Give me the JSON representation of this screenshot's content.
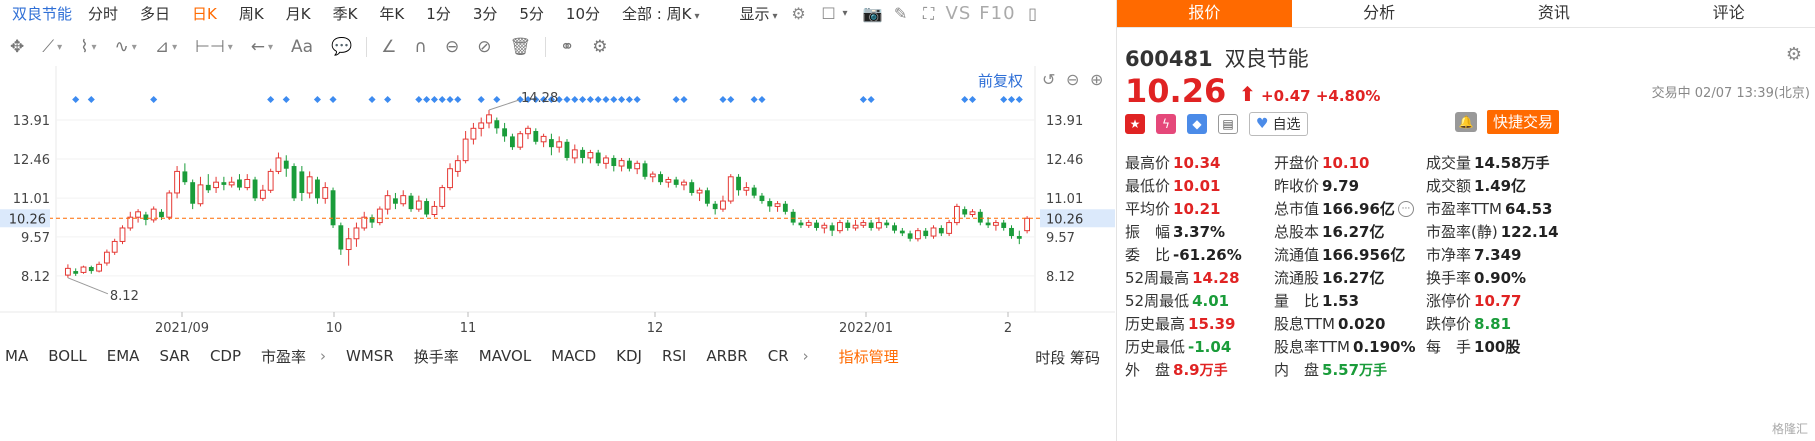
{
  "period_bar": {
    "stock_name": "双良节能",
    "tabs": [
      "分时",
      "多日",
      "日K",
      "周K",
      "月K",
      "季K",
      "年K",
      "1分",
      "3分",
      "5分",
      "10分"
    ],
    "active_tab": "日K",
    "range_select": "全部 : 周K",
    "display_label": "显示",
    "vs_label": "VS",
    "f10_label": "F10"
  },
  "draw_bar": {
    "aa_label": "Aa"
  },
  "chart_data": {
    "type": "candlestick",
    "x_tick_labels": [
      "2021/09",
      "10",
      "11",
      "12",
      "2022/01",
      "2"
    ],
    "y_tick_labels_left": [
      "13.91",
      "12.46",
      "11.01",
      "9.57",
      "8.12"
    ],
    "y_tick_labels_right": [
      "13.91",
      "12.46",
      "11.01",
      "9.57",
      "8.12"
    ],
    "y_ticks": [
      13.91,
      12.46,
      11.01,
      9.57,
      8.12
    ],
    "ylim": [
      7.3,
      14.8
    ],
    "current_price": 10.26,
    "current_price_label": "10.26",
    "max_annotation": "14.28",
    "min_annotation": "8.12",
    "series": [
      {
        "o": 8.15,
        "c": 8.4,
        "h": 8.55,
        "l": 8.05
      },
      {
        "o": 8.3,
        "c": 8.2,
        "h": 8.4,
        "l": 8.12
      },
      {
        "o": 8.25,
        "c": 8.45,
        "h": 8.5,
        "l": 8.2
      },
      {
        "o": 8.45,
        "c": 8.3,
        "h": 8.5,
        "l": 8.2
      },
      {
        "o": 8.3,
        "c": 8.55,
        "h": 8.65,
        "l": 8.25
      },
      {
        "o": 8.6,
        "c": 9.0,
        "h": 9.1,
        "l": 8.5
      },
      {
        "o": 9.0,
        "c": 9.4,
        "h": 9.5,
        "l": 8.9
      },
      {
        "o": 9.4,
        "c": 9.9,
        "h": 10.0,
        "l": 9.3
      },
      {
        "o": 9.9,
        "c": 10.3,
        "h": 10.5,
        "l": 9.8
      },
      {
        "o": 10.3,
        "c": 10.5,
        "h": 10.6,
        "l": 10.1
      },
      {
        "o": 10.4,
        "c": 10.2,
        "h": 10.5,
        "l": 10.0
      },
      {
        "o": 10.2,
        "c": 10.6,
        "h": 10.7,
        "l": 10.1
      },
      {
        "o": 10.5,
        "c": 10.3,
        "h": 10.6,
        "l": 10.2
      },
      {
        "o": 10.3,
        "c": 11.2,
        "h": 11.3,
        "l": 10.2
      },
      {
        "o": 11.2,
        "c": 12.0,
        "h": 12.2,
        "l": 11.0
      },
      {
        "o": 12.0,
        "c": 11.6,
        "h": 12.3,
        "l": 11.5
      },
      {
        "o": 11.6,
        "c": 10.8,
        "h": 11.7,
        "l": 10.6
      },
      {
        "o": 10.8,
        "c": 11.5,
        "h": 11.8,
        "l": 10.7
      },
      {
        "o": 11.5,
        "c": 11.3,
        "h": 11.9,
        "l": 11.2
      },
      {
        "o": 11.4,
        "c": 11.6,
        "h": 11.8,
        "l": 11.2
      },
      {
        "o": 11.6,
        "c": 11.5,
        "h": 11.8,
        "l": 11.3
      },
      {
        "o": 11.5,
        "c": 11.6,
        "h": 11.8,
        "l": 11.4
      },
      {
        "o": 11.7,
        "c": 11.4,
        "h": 11.9,
        "l": 11.3
      },
      {
        "o": 11.4,
        "c": 11.7,
        "h": 11.9,
        "l": 11.3
      },
      {
        "o": 11.7,
        "c": 11.0,
        "h": 11.8,
        "l": 10.9
      },
      {
        "o": 11.0,
        "c": 11.3,
        "h": 11.5,
        "l": 10.9
      },
      {
        "o": 11.3,
        "c": 12.0,
        "h": 12.1,
        "l": 11.2
      },
      {
        "o": 12.0,
        "c": 12.5,
        "h": 12.7,
        "l": 11.9
      },
      {
        "o": 12.4,
        "c": 12.1,
        "h": 12.6,
        "l": 11.8
      },
      {
        "o": 12.2,
        "c": 11.0,
        "h": 12.3,
        "l": 10.9
      },
      {
        "o": 12.0,
        "c": 11.2,
        "h": 12.2,
        "l": 10.9
      },
      {
        "o": 11.2,
        "c": 11.8,
        "h": 12.0,
        "l": 11.0
      },
      {
        "o": 11.7,
        "c": 11.0,
        "h": 11.8,
        "l": 10.8
      },
      {
        "o": 11.0,
        "c": 11.4,
        "h": 11.6,
        "l": 10.8
      },
      {
        "o": 11.3,
        "c": 10.0,
        "h": 11.4,
        "l": 9.9
      },
      {
        "o": 10.0,
        "c": 9.1,
        "h": 10.1,
        "l": 8.9
      },
      {
        "o": 9.1,
        "c": 9.5,
        "h": 9.9,
        "l": 8.5
      },
      {
        "o": 9.5,
        "c": 9.9,
        "h": 10.1,
        "l": 9.2
      },
      {
        "o": 9.9,
        "c": 10.3,
        "h": 10.5,
        "l": 9.8
      },
      {
        "o": 10.3,
        "c": 10.1,
        "h": 10.4,
        "l": 9.9
      },
      {
        "o": 10.1,
        "c": 10.6,
        "h": 10.7,
        "l": 10.0
      },
      {
        "o": 10.6,
        "c": 11.1,
        "h": 11.3,
        "l": 10.4
      },
      {
        "o": 11.0,
        "c": 10.8,
        "h": 11.2,
        "l": 10.6
      },
      {
        "o": 10.8,
        "c": 11.1,
        "h": 11.3,
        "l": 10.7
      },
      {
        "o": 11.1,
        "c": 10.6,
        "h": 11.2,
        "l": 10.5
      },
      {
        "o": 10.6,
        "c": 10.9,
        "h": 11.1,
        "l": 10.5
      },
      {
        "o": 10.9,
        "c": 10.4,
        "h": 11.0,
        "l": 10.3
      },
      {
        "o": 10.4,
        "c": 10.7,
        "h": 10.9,
        "l": 10.3
      },
      {
        "o": 10.7,
        "c": 11.4,
        "h": 11.5,
        "l": 10.6
      },
      {
        "o": 11.4,
        "c": 12.1,
        "h": 12.3,
        "l": 11.3
      },
      {
        "o": 12.0,
        "c": 12.4,
        "h": 12.6,
        "l": 11.8
      },
      {
        "o": 12.4,
        "c": 13.2,
        "h": 13.5,
        "l": 12.3
      },
      {
        "o": 13.2,
        "c": 13.6,
        "h": 13.8,
        "l": 13.0
      },
      {
        "o": 13.6,
        "c": 13.8,
        "h": 14.0,
        "l": 13.3
      },
      {
        "o": 13.8,
        "c": 14.1,
        "h": 14.28,
        "l": 13.6
      },
      {
        "o": 13.9,
        "c": 13.6,
        "h": 14.0,
        "l": 13.4
      },
      {
        "o": 13.6,
        "c": 13.3,
        "h": 13.8,
        "l": 13.1
      },
      {
        "o": 13.3,
        "c": 12.9,
        "h": 13.4,
        "l": 12.8
      },
      {
        "o": 12.9,
        "c": 13.4,
        "h": 13.5,
        "l": 12.8
      },
      {
        "o": 13.4,
        "c": 13.6,
        "h": 13.7,
        "l": 13.2
      },
      {
        "o": 13.5,
        "c": 13.1,
        "h": 13.6,
        "l": 13.0
      },
      {
        "o": 13.1,
        "c": 13.3,
        "h": 13.4,
        "l": 12.9
      },
      {
        "o": 13.2,
        "c": 12.9,
        "h": 13.4,
        "l": 12.6
      },
      {
        "o": 12.9,
        "c": 13.1,
        "h": 13.3,
        "l": 12.7
      },
      {
        "o": 13.1,
        "c": 12.5,
        "h": 13.2,
        "l": 12.4
      },
      {
        "o": 12.5,
        "c": 12.8,
        "h": 13.0,
        "l": 12.3
      },
      {
        "o": 12.8,
        "c": 12.5,
        "h": 12.9,
        "l": 12.3
      },
      {
        "o": 12.5,
        "c": 12.7,
        "h": 12.8,
        "l": 12.3
      },
      {
        "o": 12.7,
        "c": 12.3,
        "h": 12.8,
        "l": 12.2
      },
      {
        "o": 12.3,
        "c": 12.5,
        "h": 12.6,
        "l": 12.1
      },
      {
        "o": 12.5,
        "c": 12.2,
        "h": 12.6,
        "l": 12.0
      },
      {
        "o": 12.2,
        "c": 12.4,
        "h": 12.5,
        "l": 12.0
      },
      {
        "o": 12.4,
        "c": 12.1,
        "h": 12.5,
        "l": 12.0
      },
      {
        "o": 12.1,
        "c": 12.3,
        "h": 12.4,
        "l": 11.9
      },
      {
        "o": 12.3,
        "c": 11.8,
        "h": 12.4,
        "l": 11.7
      },
      {
        "o": 11.8,
        "c": 11.9,
        "h": 12.0,
        "l": 11.6
      },
      {
        "o": 11.9,
        "c": 11.6,
        "h": 12.0,
        "l": 11.5
      },
      {
        "o": 11.6,
        "c": 11.7,
        "h": 11.8,
        "l": 11.4
      },
      {
        "o": 11.7,
        "c": 11.5,
        "h": 11.8,
        "l": 11.4
      },
      {
        "o": 11.5,
        "c": 11.6,
        "h": 11.7,
        "l": 11.3
      },
      {
        "o": 11.6,
        "c": 11.2,
        "h": 11.7,
        "l": 11.1
      },
      {
        "o": 11.2,
        "c": 11.3,
        "h": 11.4,
        "l": 10.9
      },
      {
        "o": 11.3,
        "c": 10.8,
        "h": 11.4,
        "l": 10.7
      },
      {
        "o": 10.8,
        "c": 10.6,
        "h": 10.9,
        "l": 10.4
      },
      {
        "o": 10.6,
        "c": 10.9,
        "h": 11.1,
        "l": 10.5
      },
      {
        "o": 10.9,
        "c": 11.8,
        "h": 11.9,
        "l": 10.8
      },
      {
        "o": 11.8,
        "c": 11.3,
        "h": 11.9,
        "l": 11.1
      },
      {
        "o": 11.3,
        "c": 11.4,
        "h": 11.6,
        "l": 11.1
      },
      {
        "o": 11.4,
        "c": 11.1,
        "h": 11.5,
        "l": 11.0
      },
      {
        "o": 11.1,
        "c": 10.9,
        "h": 11.2,
        "l": 10.8
      },
      {
        "o": 10.9,
        "c": 10.7,
        "h": 11.0,
        "l": 10.5
      },
      {
        "o": 10.7,
        "c": 10.8,
        "h": 10.9,
        "l": 10.5
      },
      {
        "o": 10.8,
        "c": 10.5,
        "h": 10.9,
        "l": 10.4
      },
      {
        "o": 10.5,
        "c": 10.1,
        "h": 10.6,
        "l": 10.0
      },
      {
        "o": 10.1,
        "c": 10.0,
        "h": 10.2,
        "l": 9.9
      },
      {
        "o": 10.0,
        "c": 10.1,
        "h": 10.2,
        "l": 9.9
      },
      {
        "o": 10.1,
        "c": 9.9,
        "h": 10.2,
        "l": 9.8
      },
      {
        "o": 9.9,
        "c": 10.0,
        "h": 10.1,
        "l": 9.7
      },
      {
        "o": 10.0,
        "c": 9.8,
        "h": 10.1,
        "l": 9.6
      },
      {
        "o": 9.8,
        "c": 10.1,
        "h": 10.2,
        "l": 9.7
      },
      {
        "o": 10.1,
        "c": 9.9,
        "h": 10.2,
        "l": 9.8
      },
      {
        "o": 9.9,
        "c": 10.0,
        "h": 10.2,
        "l": 9.8
      },
      {
        "o": 10.0,
        "c": 10.1,
        "h": 10.2,
        "l": 9.9
      },
      {
        "o": 10.1,
        "c": 9.9,
        "h": 10.2,
        "l": 9.8
      },
      {
        "o": 9.9,
        "c": 10.1,
        "h": 10.3,
        "l": 9.8
      },
      {
        "o": 10.1,
        "c": 10.0,
        "h": 10.2,
        "l": 9.9
      },
      {
        "o": 10.0,
        "c": 9.8,
        "h": 10.1,
        "l": 9.7
      },
      {
        "o": 9.8,
        "c": 9.7,
        "h": 9.9,
        "l": 9.6
      },
      {
        "o": 9.7,
        "c": 9.5,
        "h": 9.8,
        "l": 9.4
      },
      {
        "o": 9.5,
        "c": 9.8,
        "h": 9.9,
        "l": 9.4
      },
      {
        "o": 9.8,
        "c": 9.6,
        "h": 9.9,
        "l": 9.5
      },
      {
        "o": 9.6,
        "c": 9.9,
        "h": 10.0,
        "l": 9.5
      },
      {
        "o": 9.9,
        "c": 9.7,
        "h": 10.0,
        "l": 9.6
      },
      {
        "o": 9.7,
        "c": 10.1,
        "h": 10.2,
        "l": 9.6
      },
      {
        "o": 10.1,
        "c": 10.7,
        "h": 10.8,
        "l": 10.0
      },
      {
        "o": 10.6,
        "c": 10.4,
        "h": 10.7,
        "l": 10.3
      },
      {
        "o": 10.4,
        "c": 10.5,
        "h": 10.6,
        "l": 10.3
      },
      {
        "o": 10.5,
        "c": 10.1,
        "h": 10.6,
        "l": 10.0
      },
      {
        "o": 10.1,
        "c": 10.0,
        "h": 10.3,
        "l": 9.9
      },
      {
        "o": 10.0,
        "c": 10.1,
        "h": 10.2,
        "l": 9.8
      },
      {
        "o": 10.1,
        "c": 9.9,
        "h": 10.2,
        "l": 9.8
      },
      {
        "o": 9.9,
        "c": 9.6,
        "h": 10.0,
        "l": 9.5
      },
      {
        "o": 9.6,
        "c": 9.5,
        "h": 9.8,
        "l": 9.3
      },
      {
        "o": 9.8,
        "c": 10.26,
        "h": 10.34,
        "l": 9.7
      }
    ],
    "signal_dot_indices": [
      1,
      3,
      11,
      26,
      28,
      32,
      34,
      39,
      41,
      45,
      46,
      47,
      48,
      49,
      50,
      53,
      55,
      58,
      59,
      60,
      61,
      62,
      63,
      64,
      65,
      66,
      67,
      68,
      69,
      70,
      71,
      72,
      73,
      78,
      79,
      84,
      85,
      88,
      89,
      102,
      103,
      115,
      116,
      120,
      121,
      122,
      124,
      127,
      128,
      129
    ],
    "colors": {
      "up": "#e53935",
      "down": "#1a9c3a",
      "dot": "#3d8bf0",
      "ref": "#ff6a00"
    },
    "grid": true
  },
  "chart_toolbar": {
    "fuquan_label": "前复权"
  },
  "indicators": {
    "items": [
      "MA",
      "BOLL",
      "EMA",
      "SAR",
      "CDP",
      "市盈率",
      "WMSR",
      "换手率",
      "MAVOL",
      "MACD",
      "KDJ",
      "RSI",
      "ARBR",
      "CR"
    ],
    "manage_label": "指标管理",
    "right_tabs": "时段  筹码"
  },
  "right_panel": {
    "tabs": [
      "报价",
      "分析",
      "资讯",
      "评论"
    ],
    "active_tab": "报价",
    "code": "600481",
    "name": "双良节能",
    "price": "10.26",
    "arrow": "⬆",
    "change": "+0.47",
    "change_pct": "+4.80%",
    "status_text": "交易中 02/07 13:39(北京)",
    "fav_label": "自选",
    "quick_trade_label": "快捷交易",
    "watermark": "格隆汇",
    "stats": [
      [
        {
          "label": "最高价",
          "value": "10.34",
          "color": "red"
        },
        {
          "label": "开盘价",
          "value": "10.10",
          "color": "red"
        },
        {
          "label": "成交量",
          "value": "14.58",
          "unit": "万手",
          "color": "normal"
        }
      ],
      [
        {
          "label": "最低价",
          "value": "10.01",
          "color": "red"
        },
        {
          "label": "昨收价",
          "value": "9.79",
          "color": "normal"
        },
        {
          "label": "成交额",
          "value": "1.49亿",
          "color": "normal"
        }
      ],
      [
        {
          "label": "平均价",
          "value": "10.21",
          "color": "red"
        },
        {
          "label": "总市值",
          "value": "166.96亿",
          "color": "normal",
          "more": true
        },
        {
          "label": "市盈率TTM",
          "value": "64.53",
          "color": "normal"
        }
      ],
      [
        {
          "label": "振　幅",
          "value": "3.37%",
          "color": "normal"
        },
        {
          "label": "总股本",
          "value": "16.27亿",
          "color": "normal"
        },
        {
          "label": "市盈率(静)",
          "value": "122.14",
          "color": "normal"
        }
      ],
      [
        {
          "label": "委　比",
          "value": "-61.26%",
          "color": "normal"
        },
        {
          "label": "流通值",
          "value": "166.956亿",
          "color": "normal"
        },
        {
          "label": "市净率",
          "value": "7.349",
          "color": "normal"
        }
      ],
      [
        {
          "label": "52周最高",
          "value": "14.28",
          "color": "red"
        },
        {
          "label": "流通股",
          "value": "16.27亿",
          "color": "normal"
        },
        {
          "label": "换手率",
          "value": "0.90%",
          "color": "normal"
        }
      ],
      [
        {
          "label": "52周最低",
          "value": "4.01",
          "color": "green"
        },
        {
          "label": "量　比",
          "value": "1.53",
          "color": "normal"
        },
        {
          "label": "涨停价",
          "value": "10.77",
          "color": "red"
        }
      ],
      [
        {
          "label": "历史最高",
          "value": "15.39",
          "color": "red"
        },
        {
          "label": "股息TTM",
          "value": "0.020",
          "color": "normal"
        },
        {
          "label": "跌停价",
          "value": "8.81",
          "color": "green"
        }
      ],
      [
        {
          "label": "历史最低",
          "value": "-1.04",
          "color": "green"
        },
        {
          "label": "股息率TTM",
          "value": "0.190%",
          "color": "normal"
        },
        {
          "label": "每　手",
          "value": "100股",
          "color": "normal"
        }
      ],
      [
        {
          "label": "外　盘",
          "value": "8.9",
          "unit": "万手",
          "color": "red"
        },
        {
          "label": "内　盘",
          "value": "5.57",
          "unit": "万手",
          "color": "green"
        },
        {
          "label": "",
          "value": "",
          "color": "normal"
        }
      ]
    ]
  }
}
